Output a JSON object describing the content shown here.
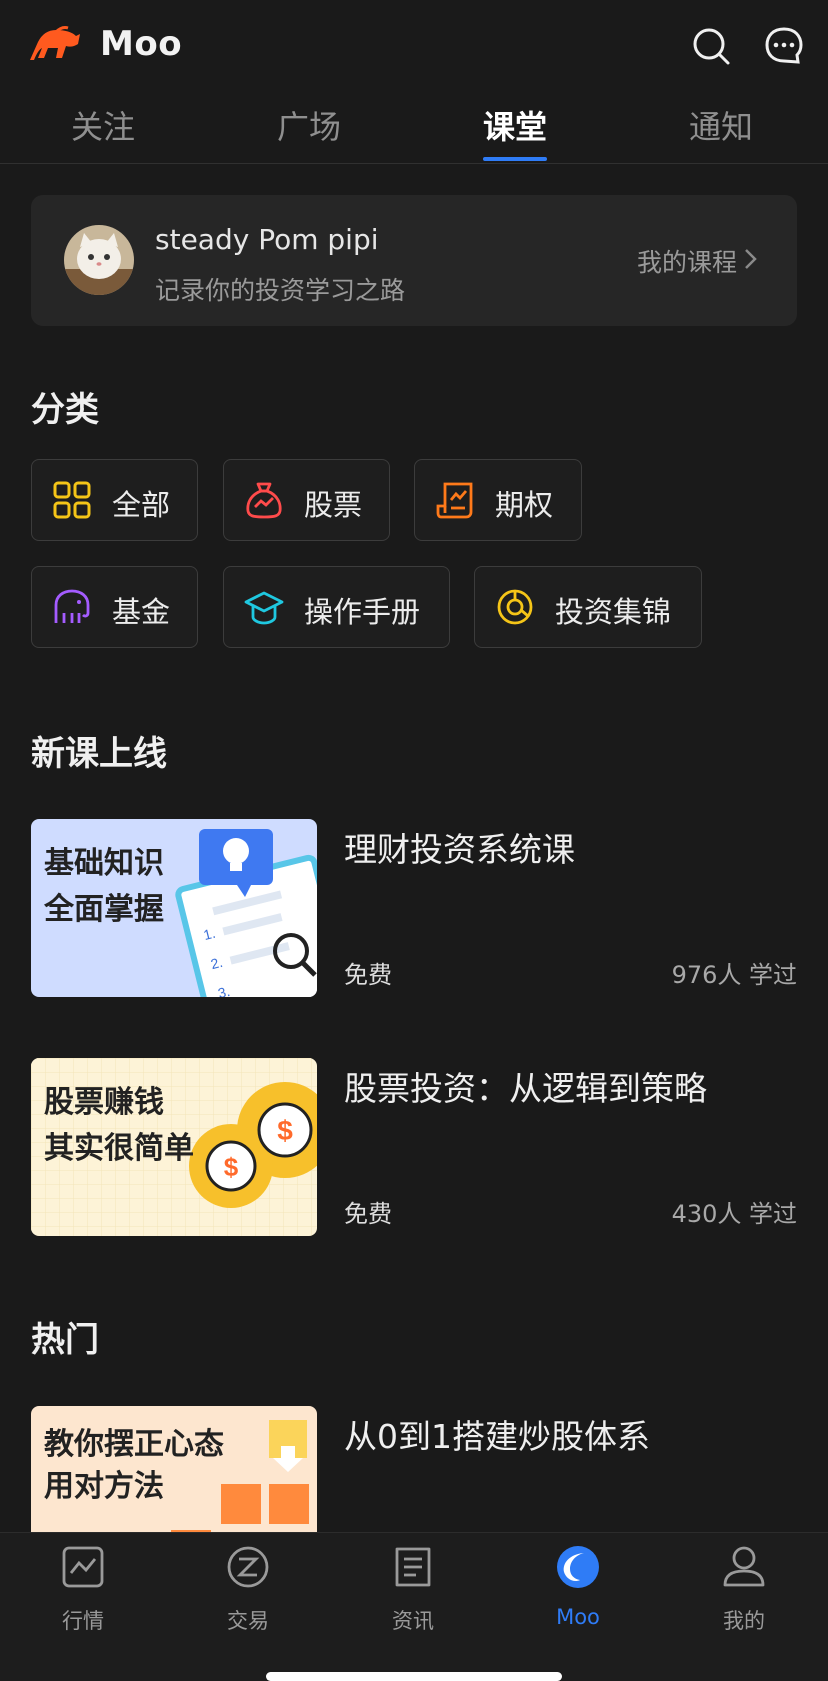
{
  "header": {
    "app_title": "Moo",
    "logo_icon": "bull-logo-icon",
    "search_icon": "search-icon",
    "message_icon": "chat-bubble-icon"
  },
  "tabs": [
    {
      "label": "关注",
      "active": false
    },
    {
      "label": "广场",
      "active": false
    },
    {
      "label": "课堂",
      "active": true
    },
    {
      "label": "通知",
      "active": false
    }
  ],
  "profile": {
    "name": "steady Pom pipi",
    "subtitle": "记录你的投资学习之路",
    "my_courses_label": "我的课程"
  },
  "categories": {
    "title": "分类",
    "items": [
      {
        "label": "全部",
        "icon": "grid-icon",
        "color": "#f5c518"
      },
      {
        "label": "股票",
        "icon": "money-bag-icon",
        "color": "#ff4b4b"
      },
      {
        "label": "期权",
        "icon": "document-chart-icon",
        "color": "#ff7a1a"
      },
      {
        "label": "基金",
        "icon": "elephant-icon",
        "color": "#a45cff"
      },
      {
        "label": "操作手册",
        "icon": "graduation-cap-icon",
        "color": "#1fc8e0"
      },
      {
        "label": "投资集锦",
        "icon": "pie-chart-icon",
        "color": "#f5c518"
      }
    ]
  },
  "new_courses": {
    "title": "新课上线",
    "items": [
      {
        "thumb_line1": "基础知识",
        "thumb_line2": "全面掌握",
        "title": "理财投资系统课",
        "price": "免费",
        "learners": "976人 学过"
      },
      {
        "thumb_line1": "股票赚钱",
        "thumb_line2": "其实很简单",
        "title": "股票投资：从逻辑到策略",
        "price": "免费",
        "learners": "430人 学过"
      }
    ]
  },
  "hot": {
    "title": "热门",
    "items": [
      {
        "thumb_line1": "教你摆正心态",
        "thumb_line2": "用对方法",
        "title": "从0到1搭建炒股体系"
      }
    ]
  },
  "bottom_nav": [
    {
      "label": "行情",
      "icon": "market-chart-icon",
      "active": false
    },
    {
      "label": "交易",
      "icon": "trade-icon",
      "active": false
    },
    {
      "label": "资讯",
      "icon": "news-icon",
      "active": false
    },
    {
      "label": "Moo",
      "icon": "moo-icon",
      "active": true
    },
    {
      "label": "我的",
      "icon": "profile-icon",
      "active": false
    }
  ],
  "colors": {
    "background": "#1a1a1a",
    "accent": "#2f7cf6",
    "brand_orange": "#ff5a1f"
  }
}
